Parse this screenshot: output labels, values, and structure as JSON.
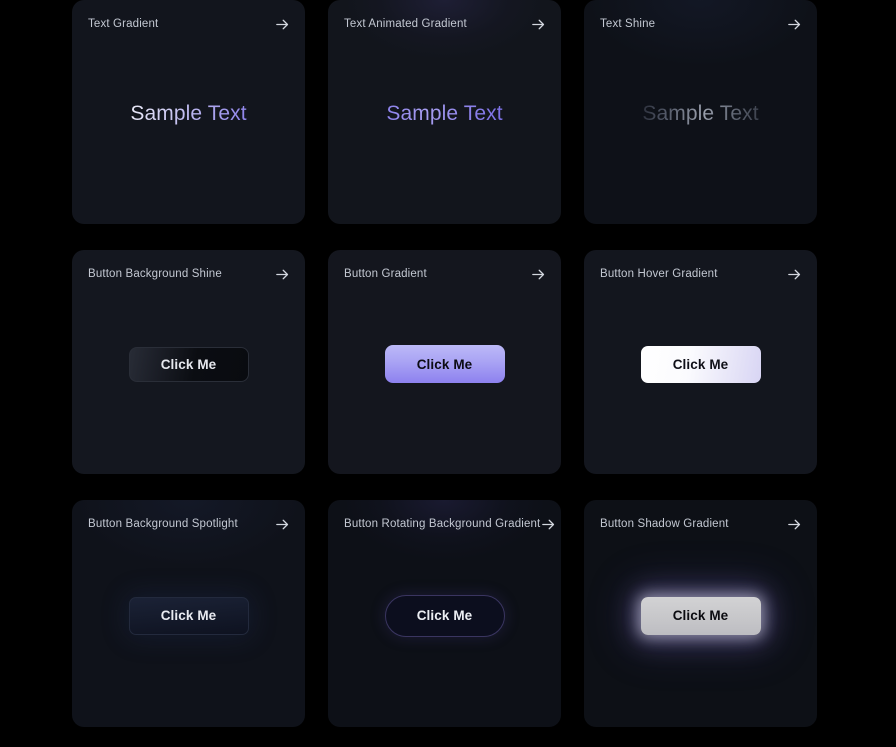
{
  "page": {
    "background_color": "#000000",
    "card_background_color": "#14171f",
    "accent_color": "#8d82ea",
    "arrow_icon": "arrow-right-icon"
  },
  "cards": [
    {
      "id": "text-gradient",
      "title": "Text Gradient",
      "demo_type": "text",
      "demo_label": "Sample Text",
      "arrow": "→"
    },
    {
      "id": "text-animated-gradient",
      "title": "Text Animated Gradient",
      "demo_type": "text",
      "demo_label": "Sample Text",
      "arrow": "→"
    },
    {
      "id": "text-shine",
      "title": "Text Shine",
      "demo_type": "text",
      "demo_label": "Sample Text",
      "arrow": "→"
    },
    {
      "id": "button-background-shine",
      "title": "Button Background Shine",
      "demo_type": "button",
      "demo_label": "Click Me",
      "arrow": "→"
    },
    {
      "id": "button-gradient",
      "title": "Button Gradient",
      "demo_type": "button",
      "demo_label": "Click Me",
      "arrow": "→"
    },
    {
      "id": "button-hover-gradient",
      "title": "Button Hover Gradient",
      "demo_type": "button",
      "demo_label": "Click Me",
      "arrow": "→"
    },
    {
      "id": "button-background-spotlight",
      "title": "Button Background Spotlight",
      "demo_type": "button",
      "demo_label": "Click Me",
      "arrow": "→"
    },
    {
      "id": "button-rotating-background-gradient",
      "title": "Button Rotating Background Gradient",
      "demo_type": "button",
      "demo_label": "Click Me",
      "arrow": "→"
    },
    {
      "id": "button-shadow-gradient",
      "title": "Button Shadow Gradient",
      "demo_type": "button",
      "demo_label": "Click Me",
      "arrow": "→"
    }
  ]
}
